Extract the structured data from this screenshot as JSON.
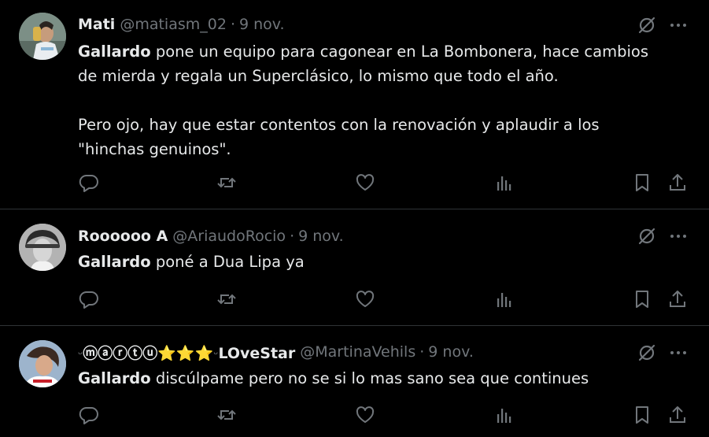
{
  "tweets": [
    {
      "name": "Mati",
      "handle": "@matiasm_02",
      "separator": "·",
      "date": "9 nov.",
      "mention": "Gallardo",
      "text_line1": " pone un equipo para cagonear en La Bombonera, hace cambios",
      "text_line2": "de mierda y regala un Superclásico, lo mismo que todo el año.",
      "text_line3": "Pero ojo, hay que estar contentos con la renovación y aplaudir a los",
      "text_line4": "\"hinchas genuinos\"."
    },
    {
      "name": "Roooooo A",
      "handle": "@AriaudoRocio",
      "separator": "·",
      "date": "9 nov.",
      "mention": "Gallardo",
      "text": " poné a Dua Lipa ya"
    },
    {
      "name_prefix": "ⓜⓐⓡⓣⓤ",
      "name_stars": "⭐⭐⭐",
      "name_suffix": "LOveStar",
      "handle": "@MartinaVehils",
      "separator": "·",
      "date": "9 nov.",
      "mention": "Gallardo",
      "text": " discúlpame pero no se si lo mas sano sea que continues"
    }
  ],
  "icons": {
    "reply": "reply-icon",
    "retweet": "retweet-icon",
    "like": "like-icon",
    "views": "views-icon",
    "bookmark": "bookmark-icon",
    "share": "share-icon",
    "grok": "grok-icon",
    "more": "more-icon"
  },
  "colors": {
    "background": "#000000",
    "text": "#e7e9ea",
    "secondary": "#71767b",
    "divider": "#2f3336",
    "star": "#f4a623"
  }
}
